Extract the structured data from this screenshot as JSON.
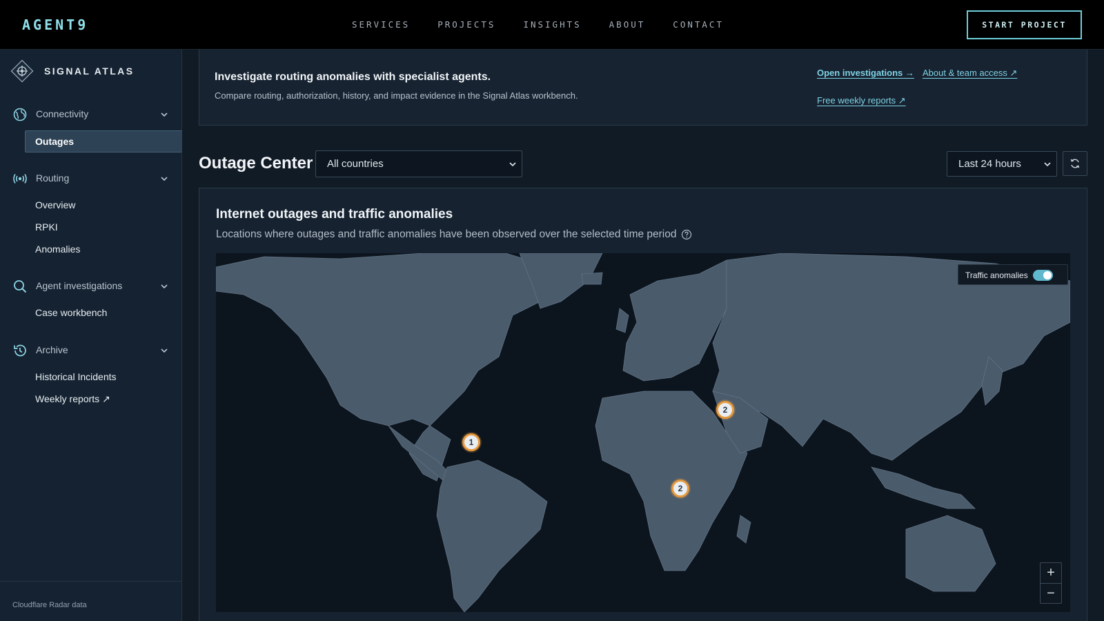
{
  "topnav": {
    "brand": "AGENT9",
    "links": [
      "SERVICES",
      "PROJECTS",
      "INSIGHTS",
      "ABOUT",
      "CONTACT"
    ],
    "cta": "START PROJECT"
  },
  "sidebar": {
    "brand": "SIGNAL ATLAS",
    "sections": [
      {
        "label": "Connectivity",
        "icon": "globe-icon",
        "items": [
          "Outages"
        ],
        "active": "Outages"
      },
      {
        "label": "Routing",
        "icon": "broadcast-icon",
        "items": [
          "Overview",
          "RPKI",
          "Anomalies"
        ]
      },
      {
        "label": "Agent investigations",
        "icon": "search-icon",
        "items": [
          "Case workbench"
        ]
      },
      {
        "label": "Archive",
        "icon": "history-icon",
        "items": [
          "Historical Incidents",
          "Weekly reports ↗"
        ]
      }
    ],
    "footer": "Cloudflare Radar data"
  },
  "banner": {
    "title": "Investigate routing anomalies with specialist agents.",
    "text": "Compare routing, authorization, history, and impact evidence in the Signal Atlas workbench.",
    "links": {
      "open": "Open investigations →",
      "about": "About & team access ↗",
      "weekly": "Free weekly reports ↗"
    }
  },
  "header": {
    "title": "Outage Center",
    "country_select": "All countries",
    "range_select": "Last 24 hours"
  },
  "map_card": {
    "title": "Internet outages and traffic anomalies",
    "subtitle": "Locations where outages and traffic anomalies have been observed over the selected time period",
    "toggle_label": "Traffic anomalies",
    "toggle_on": true,
    "markers": [
      {
        "count": "1",
        "region": "Caribbean"
      },
      {
        "count": "2",
        "region": "Middle East"
      },
      {
        "count": "2",
        "region": "Central Africa"
      }
    ],
    "zoom_in": "+",
    "zoom_out": "−"
  },
  "colors": {
    "accent": "#7fd3e4",
    "land": "#4a5b6c",
    "ocean": "#0c141d",
    "marker_ring": "#e79a3f"
  }
}
